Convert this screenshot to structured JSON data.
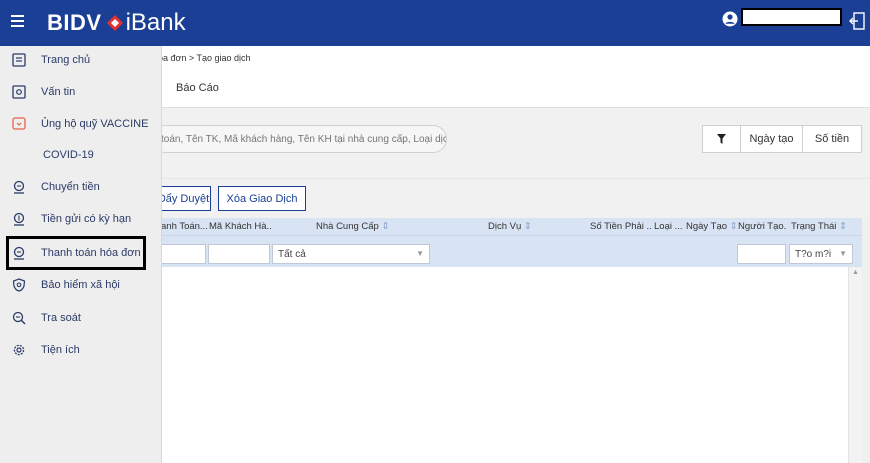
{
  "app": {
    "logo_bidv": "BIDV",
    "logo_ibank": "iBank"
  },
  "sidebar": {
    "items": [
      {
        "label": "Trang chủ",
        "icon": "home-icon"
      },
      {
        "label": "Vấn tin",
        "icon": "inquiry-icon"
      },
      {
        "label": "Ủng hộ quỹ VACCINE",
        "icon": "donate-icon"
      },
      {
        "label": "COVID-19",
        "icon": ""
      },
      {
        "label": "Chuyển tiền",
        "icon": "transfer-icon"
      },
      {
        "label": "Tiền gửi có kỳ hạn",
        "icon": "deposit-icon"
      },
      {
        "label": "Thanh toán hóa đơn",
        "icon": "bill-payment-icon"
      },
      {
        "label": "Bảo hiểm xã hội",
        "icon": "social-insurance-icon"
      },
      {
        "label": "Tra soát",
        "icon": "search-icon"
      },
      {
        "label": "Tiện ích",
        "icon": "gear-icon"
      }
    ]
  },
  "breadcrumb": "óa đơn > Tạo giao dịch",
  "tabs": {
    "report": "Báo Cáo"
  },
  "search": {
    "placeholder": "toán, Tên TK, Mã khách hàng, Tên KH tại nhà cung cấp, Loại dịch"
  },
  "sort": {
    "filter_icon": "filter-icon",
    "date": "Ngày tạo",
    "amount": "Số tiền"
  },
  "actions": {
    "cancel_approve": "Đẩy Duyệt",
    "delete": "Xóa Giao Dịch"
  },
  "table": {
    "headers": {
      "payment": "anh Toán...",
      "customer_code": "Mã Khách Hà...",
      "provider": "Nhà Cung Cấp",
      "service": "Dịch Vụ",
      "amount_due": "Số Tiền Phải ...",
      "type": "Loại ...",
      "date_created": "Ngày Tạo",
      "creator": "Người Tạo...",
      "status": "Trạng Thái"
    },
    "sort_glyph": "⇕",
    "filters": {
      "provider": "Tất cả",
      "status": "T?o m?i"
    }
  }
}
